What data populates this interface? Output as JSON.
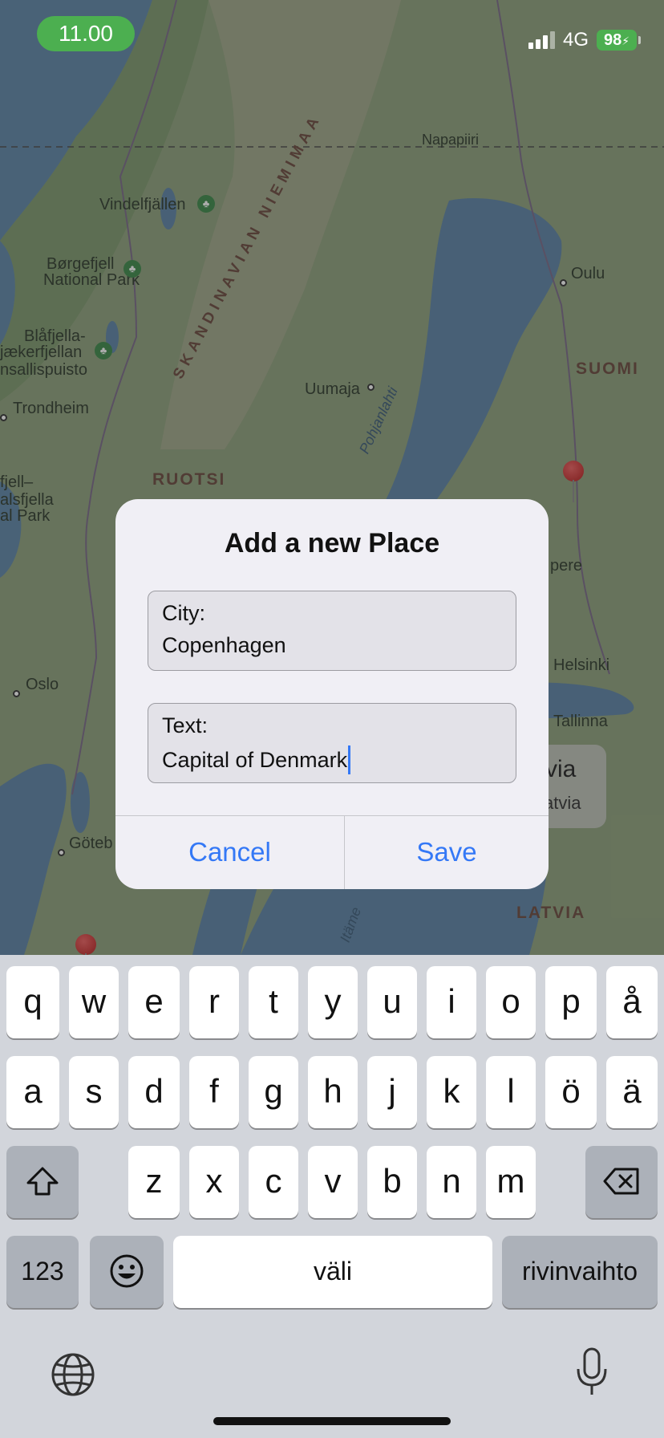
{
  "status_bar": {
    "time": "11.00",
    "network": "4G",
    "battery": "98"
  },
  "map": {
    "labels": {
      "napapiiri": "Napapiiri",
      "vindelfjallen": "Vindelfjällen",
      "borgefjell_1": "Børgefjell",
      "borgefjell_2": "National Park",
      "blafjella_1": "Blåfjella-",
      "blafjella_2": "jækerfjellan",
      "blafjella_3": "nsallispuisto",
      "trondheim": "Trondheim",
      "skandinavian": "SKANDINAVIAN NIEMIMAA",
      "oulu": "Oulu",
      "suomi": "SUOMI",
      "uumaja": "Uumaja",
      "pohjanlahti": "Pohjanlahti",
      "ruotsi": "RUOTSI",
      "fjell_1": "fjell–",
      "fjell_2": "alsfjella",
      "fjell_3": "al Park",
      "pere": "pere",
      "oslo": "Oslo",
      "helsinki": "Helsinki",
      "tallinna": "Tallinna",
      "goteb": "Göteb",
      "latvia": "LATVIA",
      "itameri": "Itäme"
    },
    "latvia_chip": {
      "big": "via",
      "small": "atvia"
    }
  },
  "dialog": {
    "title": "Add a new Place",
    "city_label": "City:",
    "city_value": "Copenhagen",
    "text_label": "Text:",
    "text_value": "Capital of Denmark",
    "cancel": "Cancel",
    "save": "Save"
  },
  "keyboard": {
    "row1": [
      "q",
      "w",
      "e",
      "r",
      "t",
      "y",
      "u",
      "i",
      "o",
      "p",
      "å"
    ],
    "row2": [
      "a",
      "s",
      "d",
      "f",
      "g",
      "h",
      "j",
      "k",
      "l",
      "ö",
      "ä"
    ],
    "row3": [
      "z",
      "x",
      "c",
      "v",
      "b",
      "n",
      "m"
    ],
    "numbers_key": "123",
    "space_key": "väli",
    "return_key": "rivinvaihto"
  }
}
